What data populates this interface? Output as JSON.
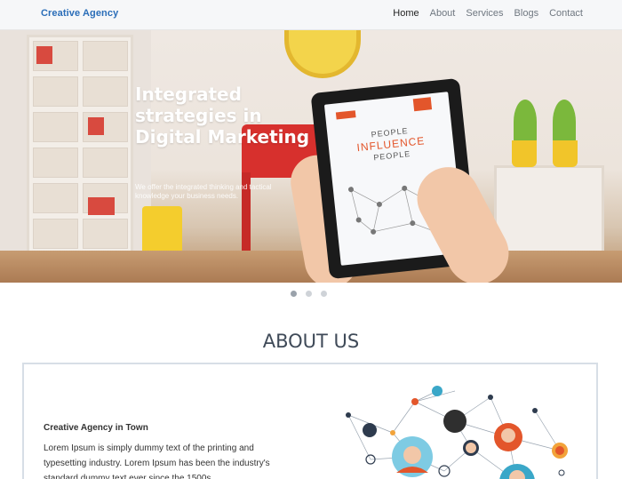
{
  "navbar": {
    "brand": "Creative Agency",
    "links": [
      "Home",
      "About",
      "Services",
      "Blogs",
      "Contact"
    ]
  },
  "hero": {
    "title": "Integrated strategies in Digital Marketing",
    "subtitle": "We offer the integrated thinking and tactical knowledge your business needs.",
    "tablet": {
      "line1": "PEOPLE",
      "line2": "INFLUENCE",
      "line3": "PEOPLE"
    }
  },
  "carousel": {
    "slides": 3,
    "active": 1
  },
  "about": {
    "title": "ABOUT US",
    "heading": "Creative Agency in Town",
    "body": "Lorem Ipsum is simply dummy text of the printing and typesetting industry. Lorem Ipsum has been the industry's standard dummy text ever since the 1500s,"
  },
  "colors": {
    "brand": "#2a6db8",
    "accent": "#e3562b",
    "heading": "#3f4a58"
  }
}
